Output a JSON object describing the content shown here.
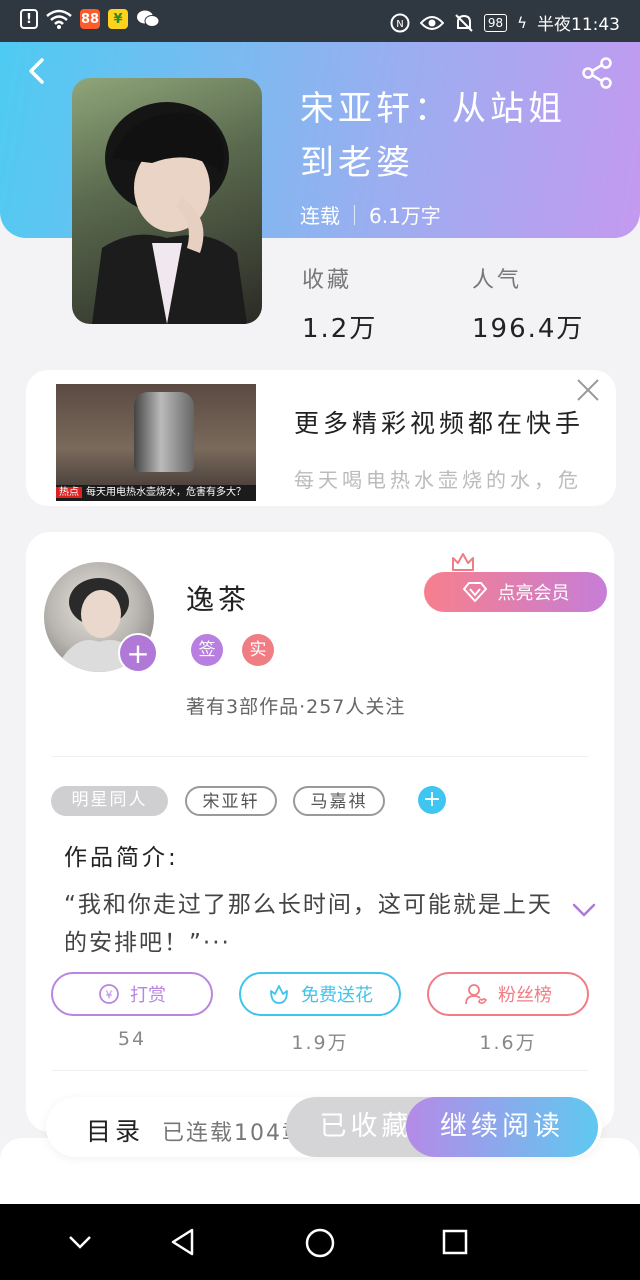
{
  "status_bar": {
    "time": "半夜11:43",
    "battery": "98",
    "icons": [
      "alert-icon",
      "wifi-icon",
      "app-icon-orange",
      "app-icon-yellow",
      "wechat-icon",
      "nfc-icon",
      "eye-icon",
      "mute-icon",
      "battery-icon",
      "charging-icon"
    ]
  },
  "book": {
    "title": "宋亚轩：从站姐到老婆",
    "status": "连载",
    "word_count": "6.1万字",
    "stats": [
      {
        "label": "收藏",
        "value": "1.2万"
      },
      {
        "label": "人气",
        "value": "196.4万"
      }
    ]
  },
  "ad": {
    "title": "更多精彩视频都在快手",
    "subtitle": "每天喝电热水壶烧的水，危",
    "image_tag": "热点",
    "image_caption": "每天用电热水壶烧水，危害有多大？"
  },
  "author": {
    "name": "逸茶",
    "badges": [
      {
        "text": "签",
        "color": "#b97fe0"
      },
      {
        "text": "实",
        "color": "#f07c84"
      }
    ],
    "works_info": "著有3部作品·257人关注",
    "vip_label": "点亮会员"
  },
  "tags": [
    "明星同人",
    "宋亚轩",
    "马嘉祺"
  ],
  "intro": {
    "heading": "作品简介:",
    "text": "“我和你走过了那么长时间，这可能就是上天的安排吧！”···"
  },
  "actions": [
    {
      "label": "打赏",
      "count": "54",
      "color": "#b886e0",
      "icon": "coin-icon"
    },
    {
      "label": "免费送花",
      "count": "1.9万",
      "color": "#3fc4ec",
      "icon": "flower-icon"
    },
    {
      "label": "粉丝榜",
      "count": "1.6万",
      "color": "#f07c84",
      "icon": "fan-icon"
    }
  ],
  "bottom": {
    "toc_label": "目录",
    "toc_sub": "已连载104章",
    "collected_label": "已收藏",
    "read_label": "继续阅读"
  },
  "colors": {
    "header_gradient_start": "#4ecbf2",
    "header_gradient_end": "#c49af0",
    "accent_purple": "#b079d8",
    "accent_blue": "#3ec5f0"
  }
}
